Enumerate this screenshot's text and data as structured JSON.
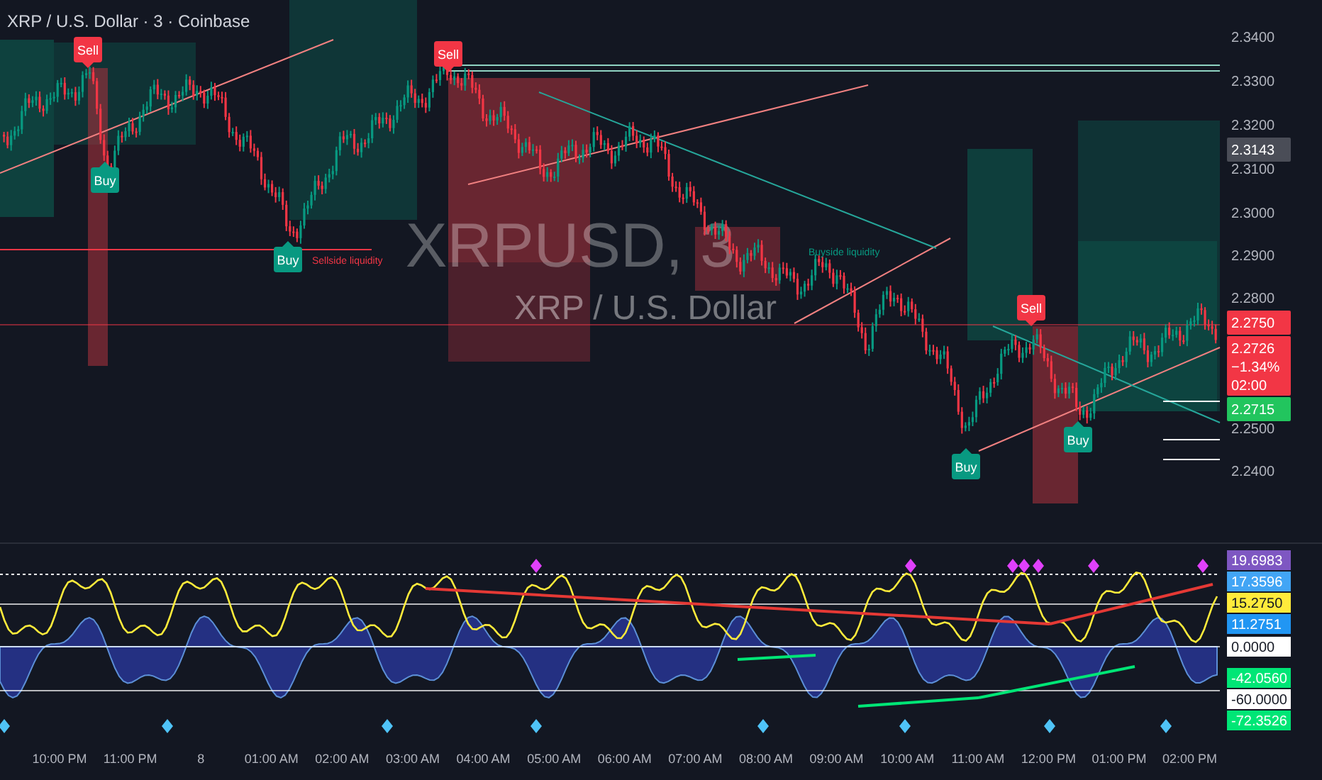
{
  "chart": {
    "title": "XRP / U.S. Dollar · 3 · Coinbase",
    "watermark_symbol": "XRPUSD, 3",
    "watermark_name": "XRP / U.S. Dollar",
    "signals": [
      {
        "kind": "sell",
        "label": "Sell"
      },
      {
        "kind": "buy",
        "label": "Buy"
      },
      {
        "kind": "buy",
        "label": "Buy"
      },
      {
        "kind": "sell",
        "label": "Sell"
      },
      {
        "kind": "sell",
        "label": "Sell"
      },
      {
        "kind": "buy",
        "label": "Buy"
      },
      {
        "kind": "buy",
        "label": "Buy"
      }
    ],
    "liquidity_labels": [
      "Sellside liquidity",
      "Buyside liquidity"
    ],
    "price_axis": [
      "2.3400",
      "2.3300",
      "2.3200",
      "2.3100",
      "2.3000",
      "2.2900",
      "2.2800",
      "2.2500",
      "2.2400"
    ],
    "price_tags": [
      {
        "kind": "previous",
        "lines": [
          "2.3143"
        ]
      },
      {
        "kind": "down",
        "lines": [
          "2.2750"
        ]
      },
      {
        "kind": "down",
        "lines": [
          "2.2726",
          "−1.34%",
          "02:00"
        ]
      },
      {
        "kind": "up",
        "lines": [
          "2.2715"
        ]
      }
    ]
  },
  "indicator": {
    "axis_tags": [
      {
        "text": "19.6983",
        "color": "#7e57c2"
      },
      {
        "text": "17.3596",
        "color": "#42a5f5"
      },
      {
        "text": "15.2750",
        "color": "#ffeb3b"
      },
      {
        "text": "11.2751",
        "color": "#2196f3"
      },
      {
        "text": "0.0000",
        "color": "#ffffff"
      },
      {
        "text": "-42.0560",
        "color": "#00e676"
      },
      {
        "text": "-60.0000",
        "color": "#ffffff"
      },
      {
        "text": "-72.3526",
        "color": "#00e676"
      }
    ]
  },
  "time_axis": [
    "10:00 PM",
    "11:00 PM",
    "8",
    "01:00 AM",
    "02:00 AM",
    "03:00 AM",
    "04:00 AM",
    "05:00 AM",
    "06:00 AM",
    "07:00 AM",
    "08:00 AM",
    "09:00 AM",
    "10:00 AM",
    "11:00 AM",
    "12:00 PM",
    "01:00 PM",
    "02:00 PM"
  ]
}
